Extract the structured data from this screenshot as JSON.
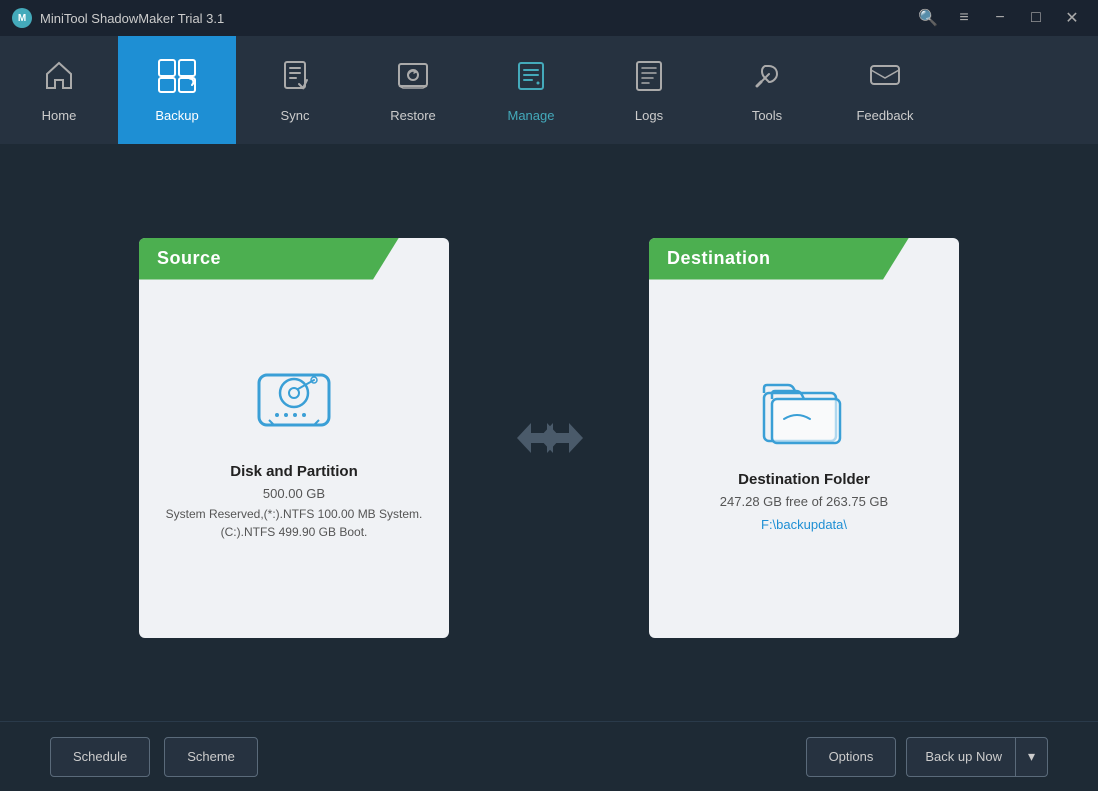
{
  "app": {
    "title": "MiniTool ShadowMaker Trial 3.1"
  },
  "titlebar": {
    "controls": {
      "search": "🔍",
      "menu": "≡",
      "minimize": "−",
      "maximize": "□",
      "close": "✕"
    }
  },
  "navbar": {
    "items": [
      {
        "id": "home",
        "label": "Home",
        "icon": "🏠"
      },
      {
        "id": "backup",
        "label": "Backup",
        "icon": "⊞",
        "active": true
      },
      {
        "id": "sync",
        "label": "Sync",
        "icon": "📄"
      },
      {
        "id": "restore",
        "label": "Restore",
        "icon": "🖥"
      },
      {
        "id": "manage",
        "label": "Manage",
        "icon": "📋"
      },
      {
        "id": "logs",
        "label": "Logs",
        "icon": "📰"
      },
      {
        "id": "tools",
        "label": "Tools",
        "icon": "🔧"
      },
      {
        "id": "feedback",
        "label": "Feedback",
        "icon": "✉"
      }
    ]
  },
  "source": {
    "header": "Source",
    "title": "Disk and Partition",
    "size": "500.00 GB",
    "detail": "System Reserved,(*:).NTFS 100.00 MB System. (C:).NTFS 499.90 GB Boot."
  },
  "destination": {
    "header": "Destination",
    "title": "Destination Folder",
    "free": "247.28 GB free of 263.75 GB",
    "path": "F:\\backupdata\\"
  },
  "bottom": {
    "schedule_label": "Schedule",
    "scheme_label": "Scheme",
    "options_label": "Options",
    "backup_now_label": "Back up Now"
  }
}
